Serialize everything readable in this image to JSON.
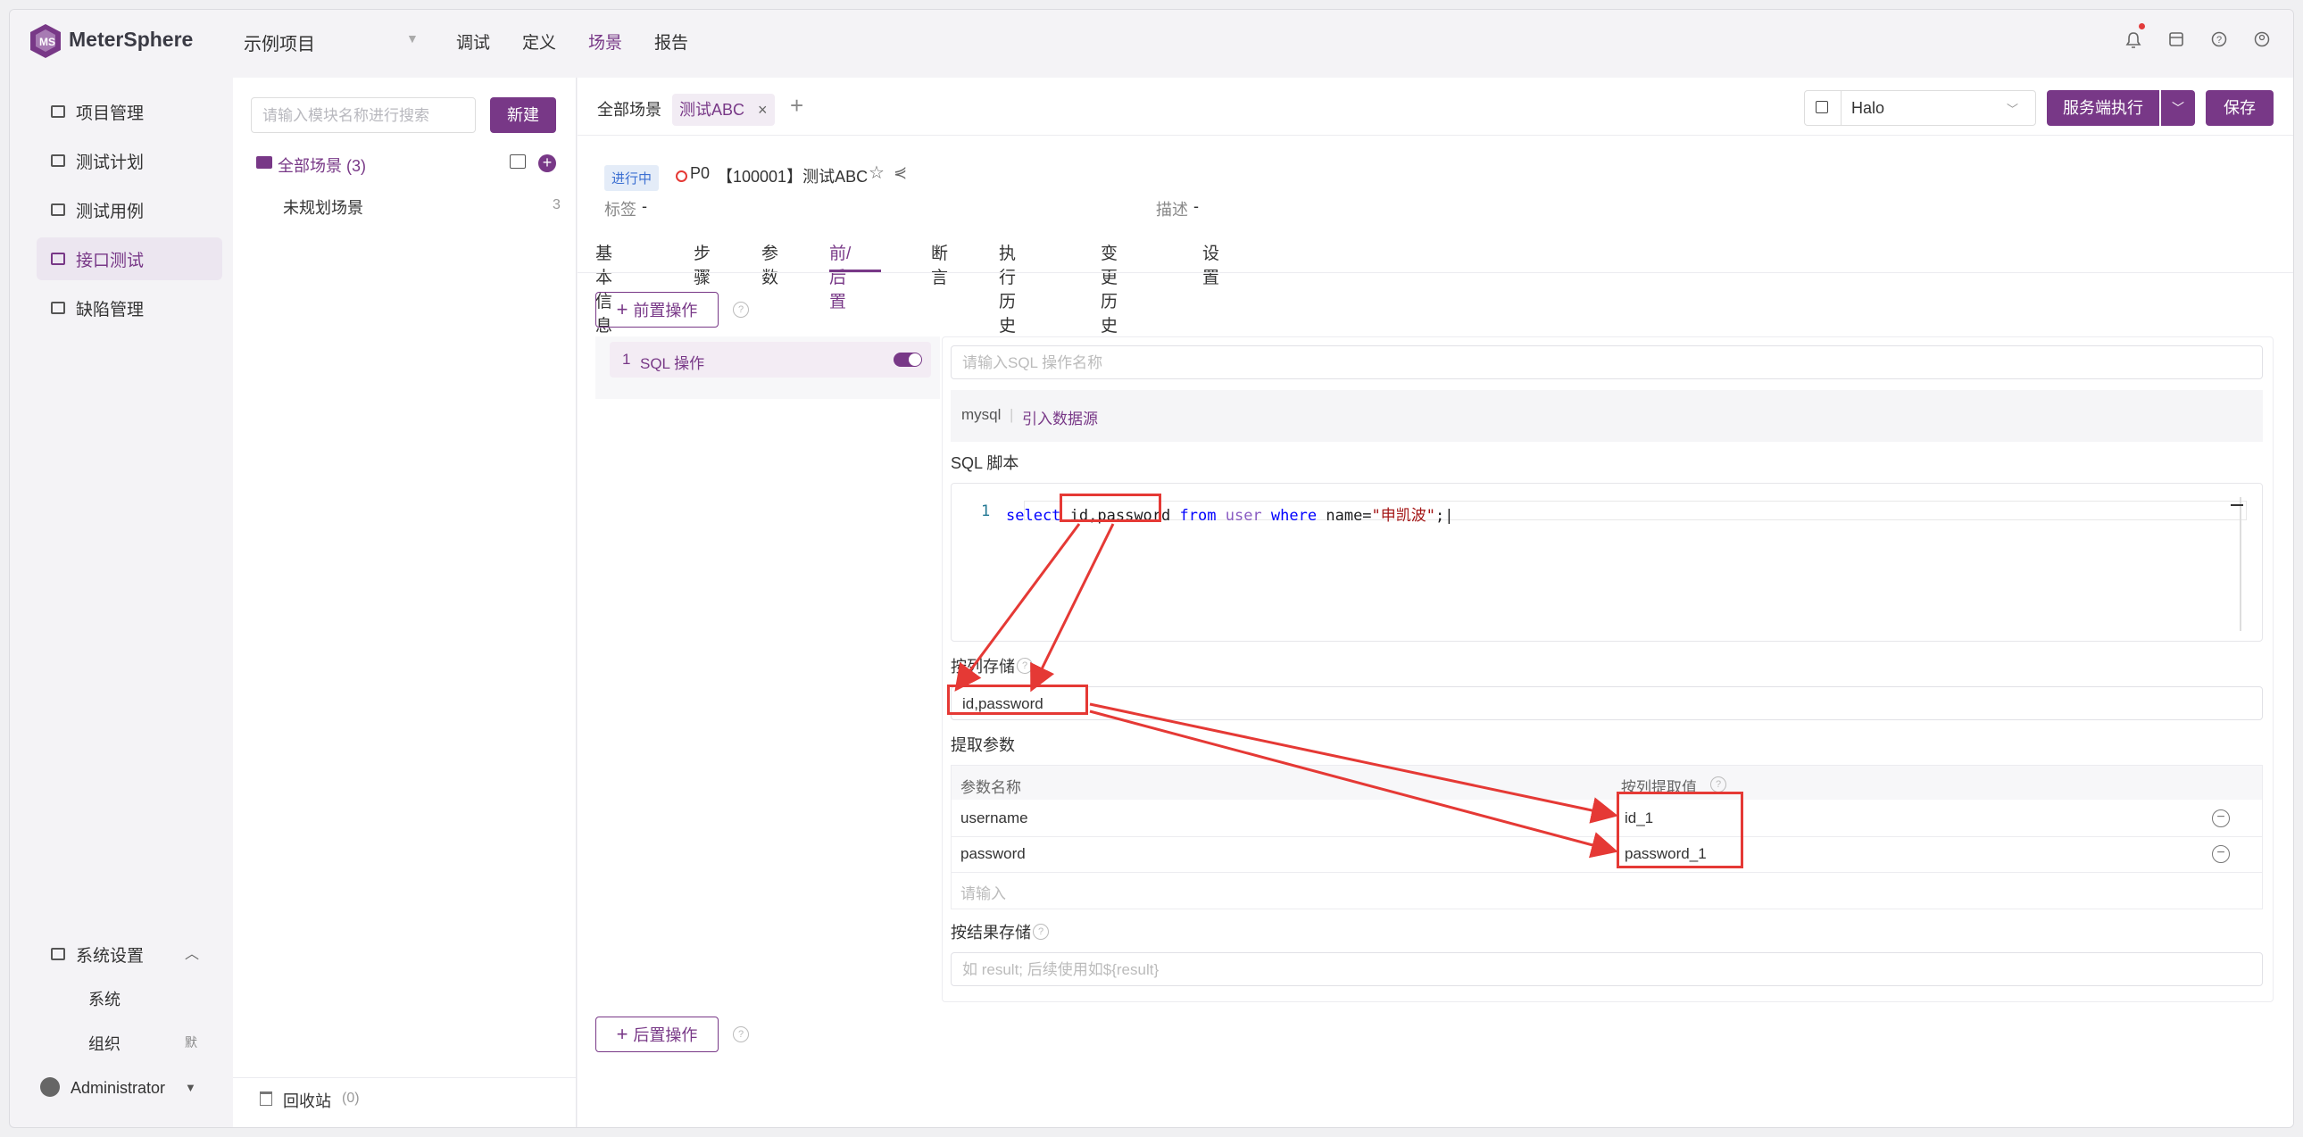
{
  "app": {
    "name": "MeterSphere",
    "project": "示例项目"
  },
  "topnav": [
    "调试",
    "定义",
    "场景",
    "报告"
  ],
  "topnav_active": "场景",
  "sidebar": {
    "items": [
      {
        "label": "项目管理",
        "icon": "folder-grid-icon"
      },
      {
        "label": "测试计划",
        "icon": "calendar-icon"
      },
      {
        "label": "测试用例",
        "icon": "layers-icon"
      },
      {
        "label": "接口测试",
        "icon": "api-icon"
      },
      {
        "label": "缺陷管理",
        "icon": "bug-icon"
      }
    ],
    "active": "接口测试",
    "settings": {
      "label": "系统设置",
      "sub": [
        "系统",
        "组织"
      ],
      "badge": "默"
    },
    "user": "Administrator"
  },
  "modules": {
    "search_placeholder": "请输入模块名称进行搜索",
    "new_label": "新建",
    "all_label": "全部场景 (3)",
    "unplanned_label": "未规划场景",
    "unplanned_count": "3",
    "recycle_label": "回收站",
    "recycle_count": "(0)"
  },
  "tabs": {
    "all": "全部场景",
    "current": "测试ABC"
  },
  "env": {
    "value": "Halo"
  },
  "actions": {
    "run": "服务端执行",
    "save": "保存"
  },
  "scenario": {
    "status": "进行中",
    "priority": "P0",
    "title": "【100001】测试ABC",
    "tags_label": "标签",
    "tags_value": "-",
    "desc_label": "描述",
    "desc_value": "-"
  },
  "subtabs": [
    "基本信息",
    "步骤",
    "参数",
    "前/后置",
    "断言",
    "执行历史",
    "变更历史",
    "设置"
  ],
  "subtab_active": "前/后置",
  "pre": {
    "add_label": "前置操作",
    "post_label": "后置操作",
    "op_index": "1",
    "op_name": "SQL 操作",
    "op_enabled": true,
    "name_placeholder": "请输入SQL 操作名称",
    "datasource": "mysql",
    "import_label": "引入数据源",
    "script_label": "SQL 脚本",
    "line_no": "1",
    "sql": {
      "select": "select",
      "cols": "id,password",
      "from": "from",
      "user": "user",
      "where": "where",
      "name_eq": "name=",
      "value": "\"申凯波\"",
      "end": ";"
    },
    "store_by_col_label": "按列存储",
    "store_by_col_value": "id,password",
    "extract_label": "提取参数",
    "table_headers": [
      "参数名称",
      "按列提取值"
    ],
    "rows": [
      {
        "name": "username",
        "value": "id_1"
      },
      {
        "name": "password",
        "value": "password_1"
      }
    ],
    "new_row_placeholder": "请输入",
    "store_by_result_label": "按结果存储",
    "result_placeholder": "如 result; 后续使用如${result}"
  },
  "colors": {
    "brand": "#783887",
    "annotation": "#e53935"
  }
}
